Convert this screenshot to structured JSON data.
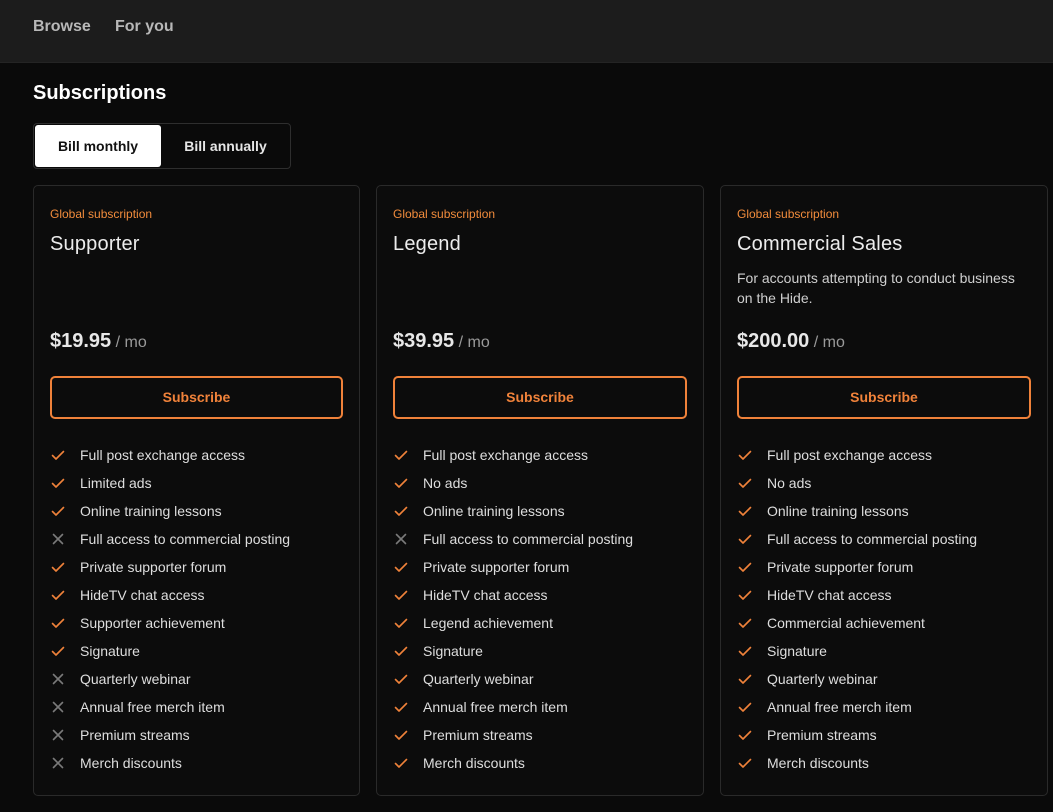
{
  "nav": {
    "browse": "Browse",
    "for_you": "For you"
  },
  "page_title": "Subscriptions",
  "billing_toggle": {
    "monthly": "Bill monthly",
    "annually": "Bill annually",
    "selected": "monthly"
  },
  "colors": {
    "accent": "#f0823a",
    "kicker": "#f28c3c",
    "check": "#f0823a",
    "cross": "#7a7a7a"
  },
  "plans": [
    {
      "kicker": "Global subscription",
      "name": "Supporter",
      "description": "",
      "price": "$19.95",
      "period": "/ mo",
      "button": "Subscribe",
      "features": [
        {
          "text": "Full post exchange access",
          "included": true,
          "icon": "check-icon"
        },
        {
          "text": "Limited ads",
          "included": true,
          "icon": "check-icon"
        },
        {
          "text": "Online training lessons",
          "included": true,
          "icon": "check-icon"
        },
        {
          "text": "Full access to commercial posting",
          "included": false,
          "icon": "cross-icon"
        },
        {
          "text": "Private supporter forum",
          "included": true,
          "icon": "check-icon"
        },
        {
          "text": "HideTV chat access",
          "included": true,
          "icon": "check-icon"
        },
        {
          "text": "Supporter achievement",
          "included": true,
          "icon": "check-icon"
        },
        {
          "text": "Signature",
          "included": true,
          "icon": "check-icon"
        },
        {
          "text": "Quarterly webinar",
          "included": false,
          "icon": "cross-icon"
        },
        {
          "text": "Annual free merch item",
          "included": false,
          "icon": "cross-icon"
        },
        {
          "text": "Premium streams",
          "included": false,
          "icon": "cross-icon"
        },
        {
          "text": "Merch discounts",
          "included": false,
          "icon": "cross-icon"
        }
      ]
    },
    {
      "kicker": "Global subscription",
      "name": "Legend",
      "description": "",
      "price": "$39.95",
      "period": "/ mo",
      "button": "Subscribe",
      "features": [
        {
          "text": "Full post exchange access",
          "included": true,
          "icon": "check-icon"
        },
        {
          "text": "No ads",
          "included": true,
          "icon": "check-icon"
        },
        {
          "text": "Online training lessons",
          "included": true,
          "icon": "check-icon"
        },
        {
          "text": "Full access to commercial posting",
          "included": false,
          "icon": "cross-icon"
        },
        {
          "text": "Private supporter forum",
          "included": true,
          "icon": "check-icon"
        },
        {
          "text": "HideTV chat access",
          "included": true,
          "icon": "check-icon"
        },
        {
          "text": "Legend achievement",
          "included": true,
          "icon": "check-icon"
        },
        {
          "text": "Signature",
          "included": true,
          "icon": "check-icon"
        },
        {
          "text": "Quarterly webinar",
          "included": true,
          "icon": "check-icon"
        },
        {
          "text": "Annual free merch item",
          "included": true,
          "icon": "check-icon"
        },
        {
          "text": "Premium streams",
          "included": true,
          "icon": "check-icon"
        },
        {
          "text": "Merch discounts",
          "included": true,
          "icon": "check-icon"
        }
      ]
    },
    {
      "kicker": "Global subscription",
      "name": "Commercial Sales",
      "description": "For accounts attempting to conduct business on the Hide.",
      "price": "$200.00",
      "period": "/ mo",
      "button": "Subscribe",
      "features": [
        {
          "text": "Full post exchange access",
          "included": true,
          "icon": "check-icon"
        },
        {
          "text": "No ads",
          "included": true,
          "icon": "check-icon"
        },
        {
          "text": "Online training lessons",
          "included": true,
          "icon": "check-icon"
        },
        {
          "text": "Full access to commercial posting",
          "included": true,
          "icon": "check-icon"
        },
        {
          "text": "Private supporter forum",
          "included": true,
          "icon": "check-icon"
        },
        {
          "text": "HideTV chat access",
          "included": true,
          "icon": "check-icon"
        },
        {
          "text": "Commercial achievement",
          "included": true,
          "icon": "check-icon"
        },
        {
          "text": "Signature",
          "included": true,
          "icon": "check-icon"
        },
        {
          "text": "Quarterly webinar",
          "included": true,
          "icon": "check-icon"
        },
        {
          "text": "Annual free merch item",
          "included": true,
          "icon": "check-icon"
        },
        {
          "text": "Premium streams",
          "included": true,
          "icon": "check-icon"
        },
        {
          "text": "Merch discounts",
          "included": true,
          "icon": "check-icon"
        }
      ]
    }
  ]
}
